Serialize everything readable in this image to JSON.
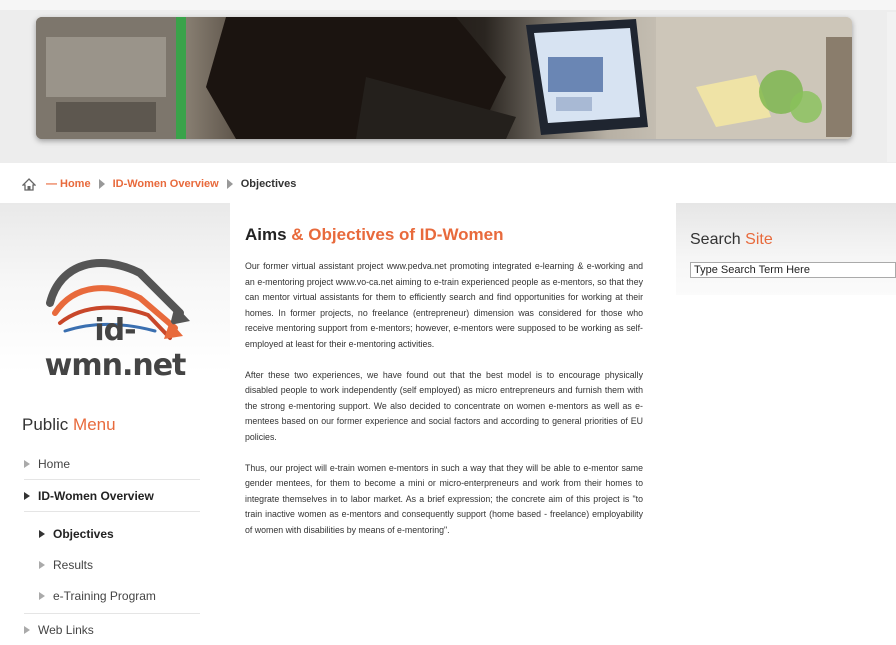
{
  "breadcrumb": {
    "dash": "—",
    "home": "Home",
    "overview": "ID-Women Overview",
    "current": "Objectives"
  },
  "logo": {
    "text": "id-wmn.net"
  },
  "menu": {
    "title_plain": "Public ",
    "title_accent": "Menu",
    "items": [
      {
        "label": "Home"
      },
      {
        "label": "ID-Women Overview"
      },
      {
        "label": "Objectives"
      },
      {
        "label": "Results"
      },
      {
        "label": "e-Training Program"
      },
      {
        "label": "Web Links"
      }
    ]
  },
  "article": {
    "title_plain": "Aims ",
    "title_accent": "& Objectives of ID-Women",
    "paragraphs": [
      "Our former virtual assistant project www.pedva.net promoting integrated e-learning & e-working and an e-mentoring project www.vo-ca.net aiming to e-train experienced people as e-mentors, so that they can mentor virtual assistants for them to efficiently search and find opportunities for working at their homes. In former projects, no freelance (entrepreneur) dimension was considered for those who receive mentoring support from e-mentors; however, e-mentors were supposed to be working as self-employed at least for their e-mentoring activities.",
      "After these two experiences, we have found out that the best model is to encourage physically disabled people to work independently (self employed) as micro entrepreneurs and furnish them with the strong e-mentoring support. We also decided to concentrate on women e-mentors as well as e-mentees based on our former experience and social factors and according to general priorities of EU policies.",
      "Thus, our project will e-train women e-mentors in such a way that they will be able to e-mentor same gender mentees, for them to become a mini or micro-enterpreneurs and work from their homes to integrate themselves in to labor market. As a brief expression; the concrete aim of this project is \"to train inactive women as e-mentors and consequently support (home based - freelance) employability of women with disabilities by means of e-mentoring\"."
    ]
  },
  "search": {
    "title_plain": "Search ",
    "title_accent": "Site",
    "input_value": "Type Search Term Here"
  },
  "colors": {
    "accent": "#e86a3c",
    "text": "#333333"
  }
}
